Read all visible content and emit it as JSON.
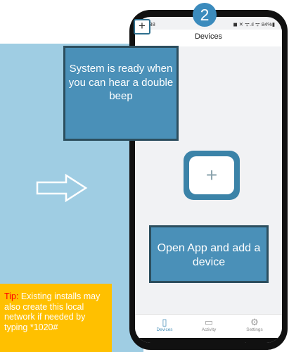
{
  "step_number": "2",
  "status_bar": {
    "time": "15:38",
    "indicators": "◼ ✕ ᯤ.ıl ᯤ 84%▮"
  },
  "app_bar": {
    "title": "Devices",
    "add_icon": "plus-icon"
  },
  "callouts": {
    "system_ready": "System is ready when you can hear a double beep",
    "open_app": "Open App and add a device"
  },
  "tip": {
    "label": "Tip:",
    "text": " Existing installs may also create this local network if needed by typing *1020#"
  },
  "bottom_nav": [
    {
      "label": "Devices",
      "icon": "device-icon"
    },
    {
      "label": "Activity",
      "icon": "chat-icon"
    },
    {
      "label": "Settings",
      "icon": "gear-icon"
    }
  ],
  "system_nav": {
    "recents": "|||",
    "home": "○",
    "back": "‹"
  },
  "colors": {
    "panel": "#9fcde3",
    "callout": "#4a90b8",
    "tip": "#ffc000",
    "accent": "#3b8bbd"
  }
}
